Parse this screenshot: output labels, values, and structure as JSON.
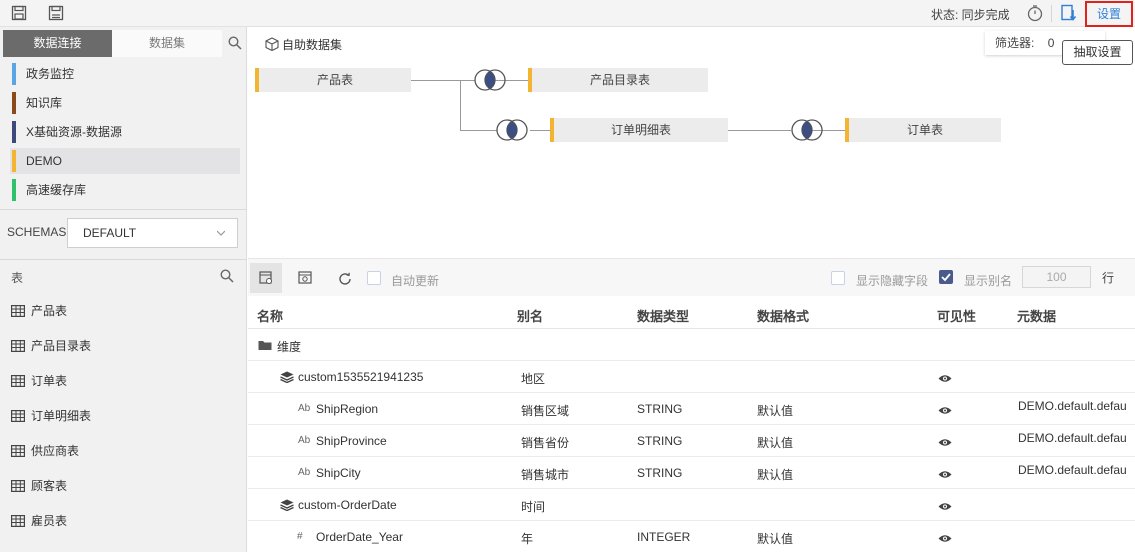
{
  "toolbar": {
    "status_text": "状态: 同步完成",
    "settings_label": "设置",
    "tooltip": "抽取设置"
  },
  "left": {
    "tab_connection": "数据连接",
    "tab_dataset": "数据集",
    "sources": [
      {
        "name": "政务监控",
        "color": "#5ba4e6"
      },
      {
        "name": "知识库",
        "color": "#8b4a1c"
      },
      {
        "name": "X基础资源-数据源",
        "color": "#3b4a7a"
      },
      {
        "name": "DEMO",
        "color": "#f2b431"
      },
      {
        "name": "高速缓存库",
        "color": "#2ec26a"
      }
    ],
    "selected_source": "DEMO",
    "schemas_label": "SCHEMAS",
    "schemas_value": "DEFAULT",
    "tables_label": "表",
    "tables": [
      "产品表",
      "产品目录表",
      "订单表",
      "订单明细表",
      "供应商表",
      "顾客表",
      "雇员表"
    ]
  },
  "diagram": {
    "title": "自助数据集",
    "filter_label": "筛选器:",
    "filter_value": "0",
    "nodes": [
      "产品表",
      "产品目录表",
      "订单明细表",
      "订单表"
    ]
  },
  "grid_toolbar": {
    "auto_update": "自动更新",
    "show_hidden": "显示隐藏字段",
    "show_alias": "显示别名",
    "limit_value": "100",
    "row_unit": "行"
  },
  "grid": {
    "columns": [
      "名称",
      "别名",
      "数据类型",
      "数据格式",
      "可见性",
      "元数据"
    ],
    "rows": [
      {
        "level": 0,
        "icon": "folder-icon",
        "name": "维度",
        "alias": "",
        "type": "",
        "format": "",
        "visible": false,
        "meta": ""
      },
      {
        "level": 1,
        "icon": "layers-icon",
        "name": "custom1535521941235",
        "alias": "地区",
        "type": "",
        "format": "",
        "visible": true,
        "meta": ""
      },
      {
        "level": 2,
        "icon": "text-field-icon",
        "name": "ShipRegion",
        "alias": "销售区域",
        "type": "STRING",
        "format": "默认值",
        "visible": true,
        "meta": "DEMO.default.defau"
      },
      {
        "level": 2,
        "icon": "text-field-icon",
        "name": "ShipProvince",
        "alias": "销售省份",
        "type": "STRING",
        "format": "默认值",
        "visible": true,
        "meta": "DEMO.default.defau"
      },
      {
        "level": 2,
        "icon": "text-field-icon",
        "name": "ShipCity",
        "alias": "销售城市",
        "type": "STRING",
        "format": "默认值",
        "visible": true,
        "meta": "DEMO.default.defau"
      },
      {
        "level": 1,
        "icon": "layers-icon",
        "name": "custom-OrderDate",
        "alias": "时间",
        "type": "",
        "format": "",
        "visible": true,
        "meta": ""
      },
      {
        "level": 2,
        "icon": "number-field-icon",
        "name": "OrderDate_Year",
        "alias": "年",
        "type": "INTEGER",
        "format": "默认值",
        "visible": true,
        "meta": ""
      }
    ]
  }
}
